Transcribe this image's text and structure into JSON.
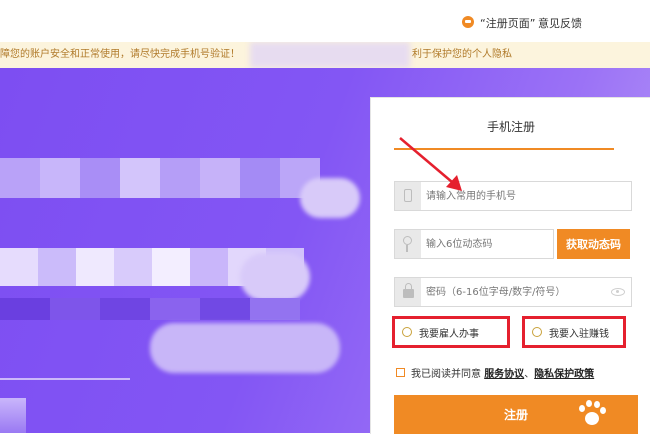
{
  "topbar": {
    "register_page_link": "“注册页面”",
    "feedback_link": "意见反馈"
  },
  "notice": {
    "text_left": "障您的账户安全和正常使用，请尽快完成手机号验证！",
    "text_right": "利于保护您的个人隐私"
  },
  "form": {
    "title": "手机注册",
    "phone_placeholder": "请输入常用的手机号",
    "code_placeholder": "输入6位动态码",
    "get_code_button": "获取动态码",
    "password_placeholder": "密码（6-16位字母/数字/符号）",
    "role_option_1": "我要雇人办事",
    "role_option_2": "我要入驻赚钱",
    "agree_text": "我已阅读并同意",
    "service_agreement": "服务协议",
    "separator": "、",
    "privacy_policy": "隐私保护政策",
    "submit_button": "注册"
  },
  "colors": {
    "accent": "#f08a24",
    "highlight_border": "#e5202e",
    "hero_purple": "#7d4ef2"
  },
  "icons": [
    "feedback-icon",
    "phone-icon",
    "key-icon",
    "lock-icon",
    "eye-icon",
    "paw-icon",
    "arrow-annotation"
  ]
}
